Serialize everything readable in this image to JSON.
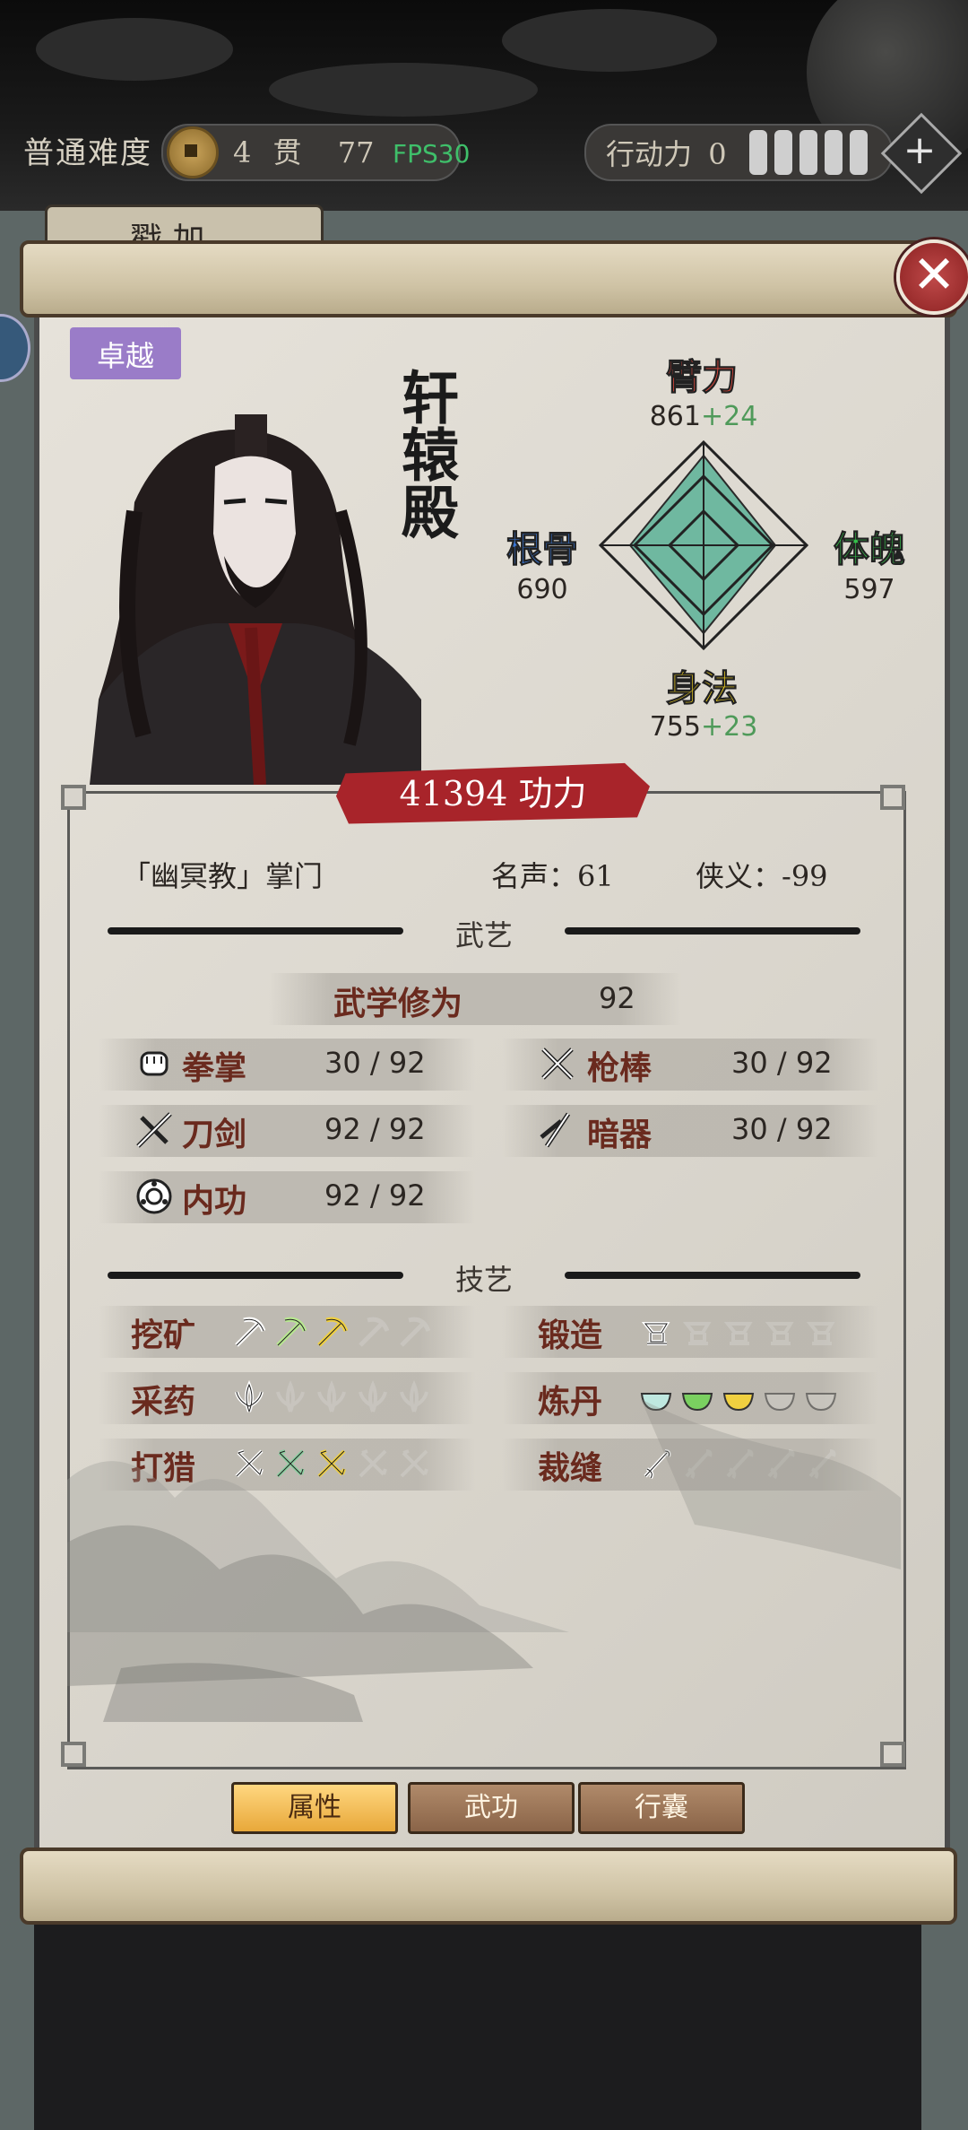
{
  "top_bar": {
    "difficulty": "普通难度",
    "currency_amount": "4",
    "currency_unit": "贯",
    "currency_sub": "77",
    "fps": "FPS30",
    "action_label": "行动力",
    "action_value": "0",
    "action_bars": 5
  },
  "background_tab": {
    "label": "戳 加"
  },
  "character": {
    "rank": "卓越",
    "name": "轩辕殿",
    "stats": {
      "strength": {
        "label": "臂力",
        "value": "861",
        "bonus": "+24",
        "color": "#e0483c"
      },
      "constitution": {
        "label": "体魄",
        "value": "597",
        "bonus": "",
        "color": "#34c04a"
      },
      "agility": {
        "label": "身法",
        "value": "755",
        "bonus": "+23",
        "color": "#f0d020"
      },
      "bone": {
        "label": "根骨",
        "value": "690",
        "bonus": "",
        "color": "#3a78d8"
      }
    },
    "power": "41394 功力",
    "sect": "「幽冥教」掌门",
    "fame": "名声：61",
    "chivalry": "侠义：-99"
  },
  "martial": {
    "section_title": "武艺",
    "cultivation_label": "武学修为",
    "cultivation_value": "92",
    "skills": [
      {
        "name": "拳掌",
        "value": "30 / 92",
        "icon": "fist-icon"
      },
      {
        "name": "枪棒",
        "value": "30 / 92",
        "icon": "spear-icon"
      },
      {
        "name": "刀剑",
        "value": "92 / 92",
        "icon": "sword-icon"
      },
      {
        "name": "暗器",
        "value": "30 / 92",
        "icon": "dart-icon"
      },
      {
        "name": "内功",
        "value": "92 / 92",
        "icon": "inner-power-icon"
      }
    ]
  },
  "crafts": {
    "section_title": "技艺",
    "items": [
      {
        "name": "挖矿",
        "level": 3,
        "max": 5,
        "icon": "pickaxe-icon"
      },
      {
        "name": "锻造",
        "level": 1,
        "max": 5,
        "icon": "anvil-icon"
      },
      {
        "name": "采药",
        "level": 1,
        "max": 5,
        "icon": "herb-icon"
      },
      {
        "name": "炼丹",
        "level": 3,
        "max": 5,
        "icon": "bowl-icon"
      },
      {
        "name": "打猎",
        "level": 3,
        "max": 5,
        "icon": "bow-icon"
      },
      {
        "name": "裁缝",
        "level": 1,
        "max": 5,
        "icon": "needle-icon"
      }
    ]
  },
  "tabs": [
    {
      "label": "属性",
      "active": true
    },
    {
      "label": "武功",
      "active": false
    },
    {
      "label": "行囊",
      "active": false
    }
  ]
}
